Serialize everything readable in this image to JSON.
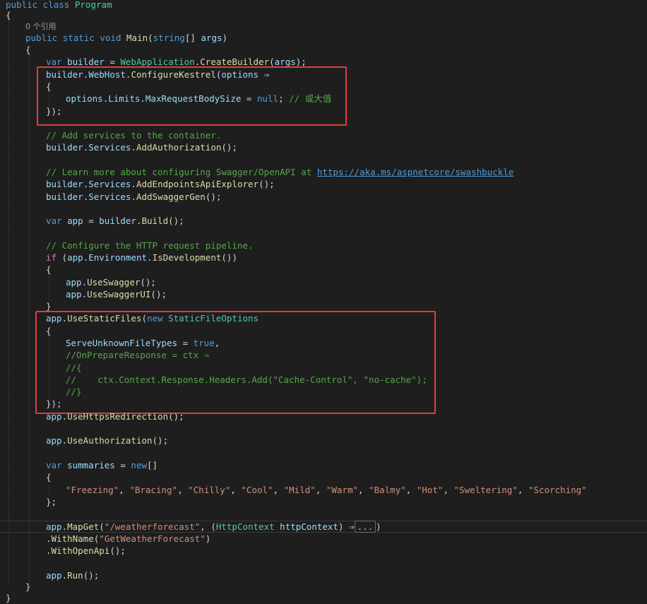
{
  "editor": {
    "codelens_refs": "0 个引用",
    "code": {
      "class_decl": {
        "kw1": "public",
        "kw2": "class",
        "name": "Program"
      },
      "main_decl": {
        "kw1": "public",
        "kw2": "static",
        "kw3": "void",
        "name": "Main",
        "paren_open": "(",
        "type": "string",
        "rest": "[] ",
        "param": "args",
        "paren_close": ")"
      },
      "var_kw": "var",
      "builder_var": "builder",
      "web_application": "WebApplication",
      "create_builder": "CreateBuilder",
      "args": "args",
      "webhost": "WebHost",
      "configure_kestrel": "ConfigureKestrel",
      "options": "options",
      "arrow": "⇒",
      "limits": "Limits",
      "max_request_body_size": "MaxRequestBodySize",
      "null_kw": "null",
      "comment_or_value": "// 或大值",
      "comment_add_services": "// Add services to the container.",
      "services": "Services",
      "add_authorization": "AddAuthorization",
      "comment_learn_more": "// Learn more about configuring Swagger/OpenAPI at ",
      "swashbuckle_url": "https://aka.ms/aspnetcore/swashbuckle",
      "add_endpoints_api_explorer": "AddEndpointsApiExplorer",
      "add_swagger_gen": "AddSwaggerGen",
      "app_var": "app",
      "build": "Build",
      "comment_configure_pipeline": "// Configure the HTTP request pipeline.",
      "if_kw": "if",
      "environment": "Environment",
      "is_development": "IsDevelopment",
      "use_swagger": "UseSwagger",
      "use_swagger_ui": "UseSwaggerUI",
      "use_static_files": "UseStaticFiles",
      "new_kw": "new",
      "static_file_options": "StaticFileOptions",
      "serve_unknown_file_types": "ServeUnknownFileTypes",
      "true_kw": "true",
      "comment_on_prepare_response": "//OnPrepareResponse = ctx ⇒",
      "comment_open_brace": "//{",
      "comment_headers_add_prefix": "//    ",
      "comment_headers_add": "ctx.Context.Response.Headers.Add(\"Cache-Control\", \"no-cache\");",
      "comment_close_brace": "//}",
      "use_https_redirection": "UseHttpsRedirection",
      "use_authorization": "UseAuthorization",
      "summaries_var": "summaries",
      "summaries_list": [
        "\"Freezing\"",
        "\"Bracing\"",
        "\"Chilly\"",
        "\"Cool\"",
        "\"Mild\"",
        "\"Warm\"",
        "\"Balmy\"",
        "\"Hot\"",
        "\"Sweltering\"",
        "\"Scorching\""
      ],
      "map_get": "MapGet",
      "weatherforecast_route": "\"/weatherforecast\"",
      "http_context_type": "HttpContext",
      "http_context_param": "httpContext",
      "collapsed_ellipsis": "...",
      "with_name": "WithName",
      "get_weather_forecast": "\"GetWeatherForecast\"",
      "with_open_api": "WithOpenApi",
      "run": "Run"
    }
  },
  "colors": {
    "background": "#1e1e1e",
    "highlight_box": "#e33b3b",
    "keyword": "#569cd6",
    "type": "#4ec9b0",
    "method": "#dcdcaa",
    "identifier": "#9cdcfe",
    "string": "#ce9178",
    "comment": "#57a64a"
  }
}
